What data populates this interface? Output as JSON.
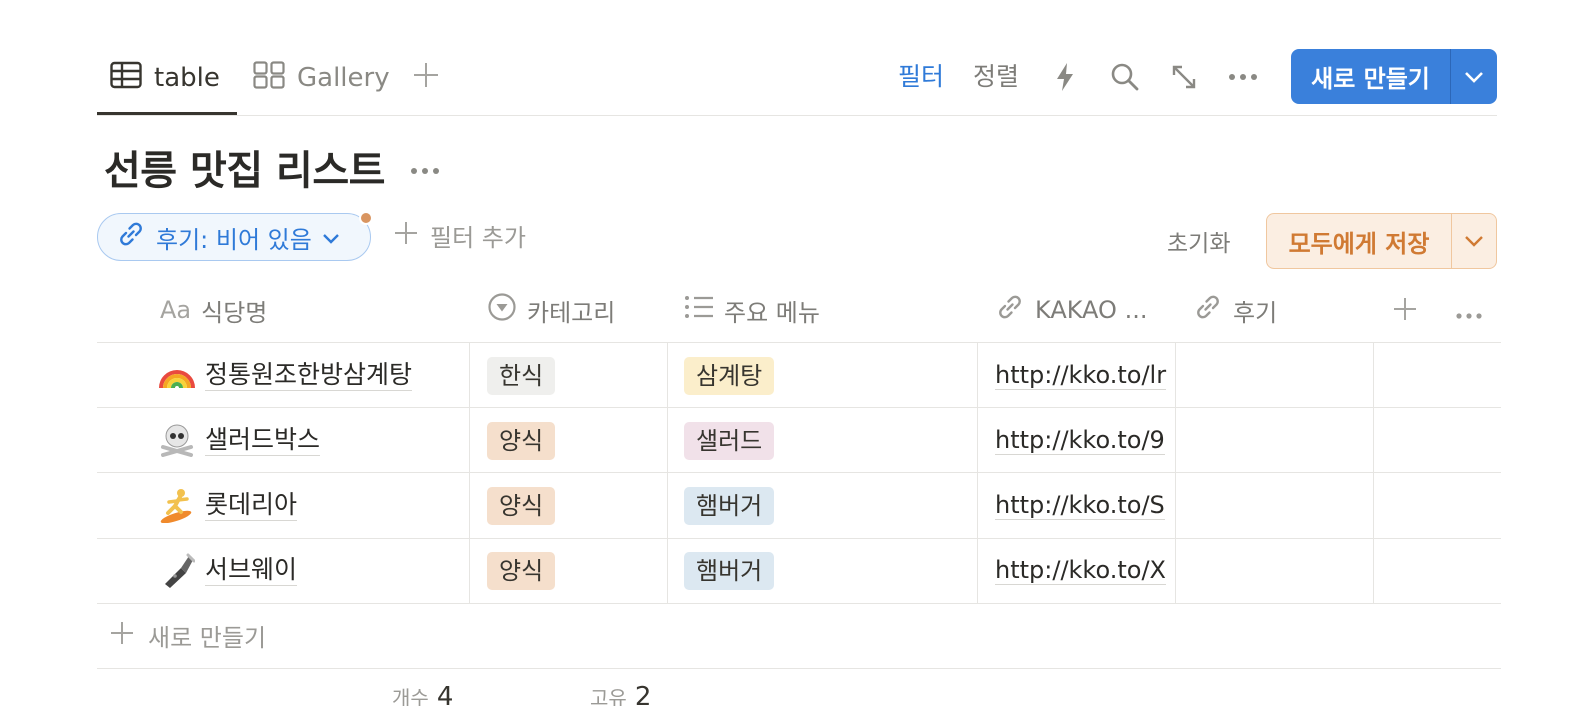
{
  "tabs": [
    {
      "label": "table",
      "icon": "table-icon",
      "active": true
    },
    {
      "label": "Gallery",
      "icon": "gallery-icon",
      "active": false
    }
  ],
  "toolbar": {
    "filter_label": "필터",
    "sort_label": "정렬",
    "new_label": "새로 만들기"
  },
  "page": {
    "title": "선릉 맛집 리스트"
  },
  "filters": {
    "active_filter": "후기: 비어 있음",
    "add_filter_label": "필터 추가",
    "reset_label": "초기화",
    "save_all_label": "모두에게 저장"
  },
  "table": {
    "columns": [
      {
        "label": "식당명",
        "icon": "text-aa-icon"
      },
      {
        "label": "카테고리",
        "icon": "select-icon"
      },
      {
        "label": "주요 메뉴",
        "icon": "list-icon"
      },
      {
        "label": "KAKAO ...",
        "icon": "link-icon"
      },
      {
        "label": "후기",
        "icon": "link-icon"
      }
    ],
    "rows": [
      {
        "emoji": "🌈",
        "name": "정통원조한방삼계탕",
        "category": "한식",
        "menu": "삼계탕",
        "link": "http://kko.to/lr",
        "review": ""
      },
      {
        "emoji": "☠️",
        "name": "샐러드박스",
        "category": "양식",
        "menu": "샐러드",
        "link": "http://kko.to/9",
        "review": ""
      },
      {
        "emoji": "🏄",
        "name": "롯데리아",
        "category": "양식",
        "menu": "햄버거",
        "link": "http://kko.to/S",
        "review": ""
      },
      {
        "emoji": "🔦",
        "name": "서브웨이",
        "category": "양식",
        "menu": "햄버거",
        "link": "http://kko.to/X",
        "review": ""
      }
    ],
    "new_row_label": "새로 만들기",
    "footer": [
      {
        "label": "개수",
        "value": "4"
      },
      {
        "label": "고유",
        "value": "2"
      }
    ]
  },
  "colors": {
    "accent": "#3a80db",
    "tag_korean": "#efefed",
    "tag_western": "#f5dfcc",
    "tag_samgyetang": "#fbeecb",
    "tag_salad": "#f1e1e9",
    "tag_burger": "#dce8f1"
  }
}
